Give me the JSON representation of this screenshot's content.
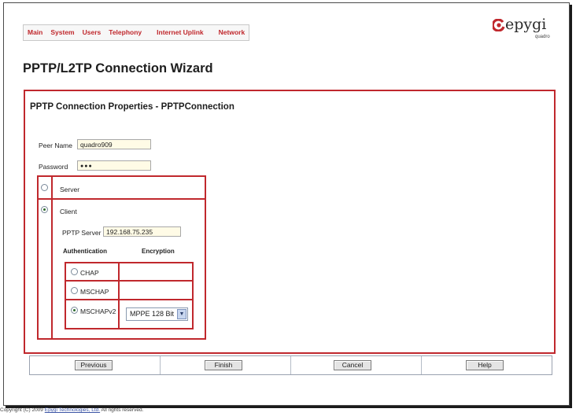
{
  "nav": {
    "items": [
      "Main",
      "System",
      "Users",
      "Telephony",
      "Internet Uplink",
      "Network"
    ]
  },
  "logo": {
    "brand": "epygi",
    "sub": "quadro",
    "accent": "#c0282d"
  },
  "page": {
    "title": "PPTP/L2TP Connection Wizard",
    "subtitle": "PPTP Connection Properties - PPTPConnection"
  },
  "form": {
    "peer_name_label": "Peer Name",
    "peer_name_value": "quadro909",
    "password_label": "Password",
    "password_value": "●●●",
    "mode_options": [
      {
        "label": "Server",
        "selected": false
      },
      {
        "label": "Client",
        "selected": true
      }
    ],
    "pptp_server_label": "PPTP Server",
    "pptp_server_value": "192.168.75.235",
    "auth_header": "Authentication",
    "enc_header": "Encryption",
    "auth_options": [
      {
        "label": "CHAP",
        "selected": false
      },
      {
        "label": "MSCHAP",
        "selected": false
      },
      {
        "label": "MSCHAPv2",
        "selected": true
      }
    ],
    "encryption_value": "MPPE 128 Bit"
  },
  "buttons": {
    "previous": "Previous",
    "finish": "Finish",
    "cancel": "Cancel",
    "help": "Help"
  },
  "footer": {
    "prefix": "Copyright (C) 2009 ",
    "company": "Epygi Technologies, Ltd.",
    "suffix": " All rights reserved."
  }
}
